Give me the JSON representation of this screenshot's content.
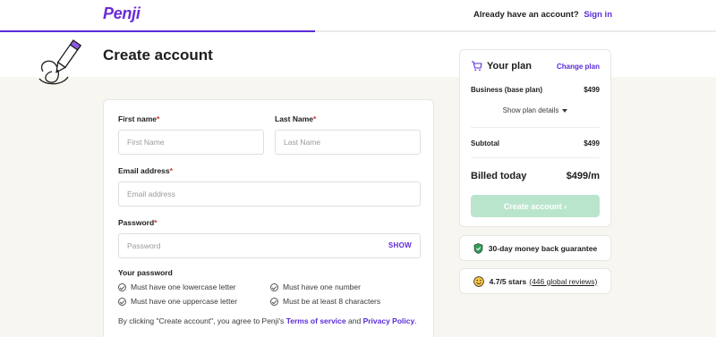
{
  "brand": {
    "logo_text": "Penji",
    "accent_color": "#5b2bd9"
  },
  "progress": {
    "fraction": 0.44
  },
  "top_nav": {
    "account_prompt": "Already have an account?",
    "signin_label": "Sign in"
  },
  "page": {
    "title": "Create account",
    "mascot_icon": "pencil-mascot-icon"
  },
  "form": {
    "first_name": {
      "label": "First name",
      "required_mark": "*",
      "placeholder": "First Name"
    },
    "last_name": {
      "label": "Last Name",
      "required_mark": "*",
      "placeholder": "Last Name"
    },
    "email": {
      "label": "Email address",
      "required_mark": "*",
      "placeholder": "Email address"
    },
    "password": {
      "label": "Password",
      "required_mark": "*",
      "placeholder": "Password",
      "show_label": "SHOW"
    },
    "requirements_title": "Your password",
    "requirements": [
      "Must have one lowercase letter",
      "Must have one number",
      "Must have one uppercase letter",
      "Must be at least 8 characters"
    ],
    "terms": {
      "prefix": "By clicking \"Create account\", you agree to Penji's",
      "tos_label": "Terms of service",
      "and": "and",
      "privacy_label": "Privacy Policy",
      "suffix": "."
    }
  },
  "plan": {
    "title": "Your plan",
    "change_label": "Change plan",
    "base_plan_name": "Business (base plan)",
    "base_plan_price": "$499",
    "details_toggle": "Show plan details",
    "subtotal_label": "Subtotal",
    "subtotal_value": "$499",
    "billed_label": "Billed today",
    "billed_value": "$499/m",
    "cta_label": "Create account  ›",
    "cta_color": "#b9e5cd"
  },
  "guarantee": {
    "icon": "shield-check-icon",
    "text": "30-day money back guarantee"
  },
  "rating": {
    "icon": "smiley-face-icon",
    "text": "4.7/5 stars",
    "reviews_label": "(446 global reviews)"
  }
}
